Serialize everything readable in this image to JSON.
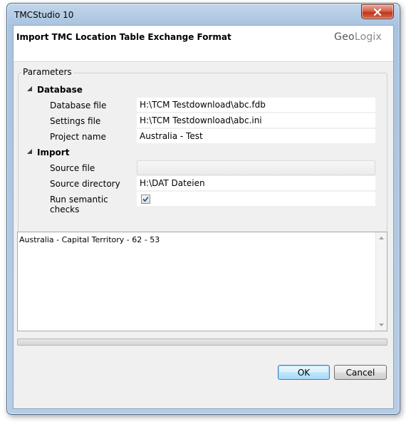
{
  "window": {
    "title": "TMCStudio 10",
    "close_icon": "close-icon"
  },
  "header": {
    "title": "Import TMC Location Table Exchange Format",
    "logo_part1": "Geo",
    "logo_part2": "Logix"
  },
  "parameters": {
    "label": "Parameters",
    "groups": [
      {
        "name": "Database",
        "rows": [
          {
            "name": "Database file",
            "value": "H:\\TCM Testdownload\\abc.fdb"
          },
          {
            "name": "Settings file",
            "value": "H:\\TCM Testdownload\\abc.ini"
          },
          {
            "name": "Project name",
            "value": "Australia - Test"
          }
        ]
      },
      {
        "name": "Import",
        "rows": [
          {
            "name": "Source file",
            "value": ""
          },
          {
            "name": "Source directory",
            "value": "H:\\DAT Dateien"
          },
          {
            "name": "Run semantic checks",
            "checked": true
          }
        ]
      }
    ]
  },
  "log": {
    "text": "Australia - Capital Territory - 62 - 53"
  },
  "progress": {
    "value": 0
  },
  "buttons": {
    "ok": "OK",
    "cancel": "Cancel"
  }
}
